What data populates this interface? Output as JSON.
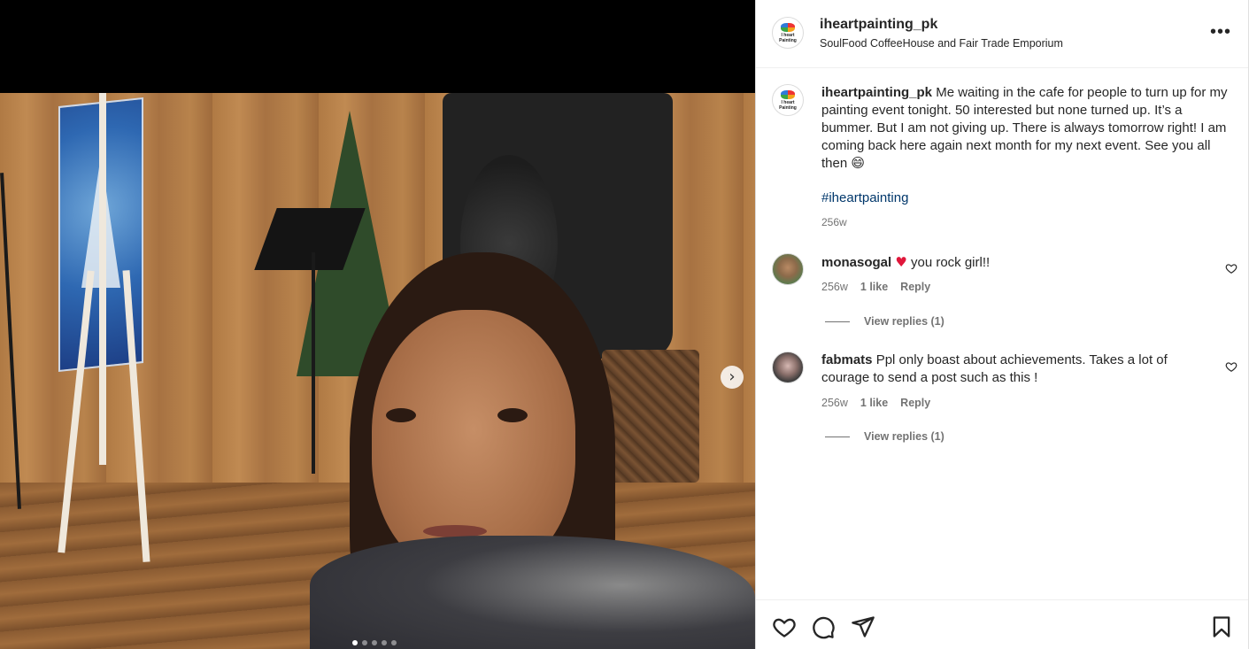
{
  "post": {
    "username": "iheartpainting_pk",
    "location": "SoulFood CoffeeHouse and Fair Trade Emporium",
    "avatar_text": "I heart Painting",
    "caption": {
      "username": "iheartpainting_pk",
      "text": "Me waiting in the cafe for people to turn up for my painting event tonight. 50 interested but none turned up. It’s a bummer. But I am not giving up. There is always tomorrow right! I am coming back here again next month for my next event. See you all then 😄",
      "hashtag": "#iheartpainting",
      "time": "256w"
    }
  },
  "comments": [
    {
      "username": "monasogal",
      "emoji": "♥",
      "text": "you rock girl!!",
      "time": "256w",
      "likes": "1 like",
      "reply_label": "Reply",
      "view_replies": "View replies (1)"
    },
    {
      "username": "fabmats",
      "text": "Ppl only boast about achievements. Takes a lot of courage to send a post such as this !",
      "time": "256w",
      "likes": "1 like",
      "reply_label": "Reply",
      "view_replies": "View replies (1)"
    }
  ],
  "carousel": {
    "total_slides": 5,
    "active_slide": 1
  },
  "icons": {
    "more": "more-options-icon",
    "next": "chevron-right-icon",
    "like": "heart-icon",
    "comment": "comment-icon",
    "share": "send-icon",
    "save": "bookmark-icon"
  },
  "colors": {
    "hashtag": "#00376b",
    "heart_emoji": "#e0173b",
    "secondary_text": "#737373"
  }
}
